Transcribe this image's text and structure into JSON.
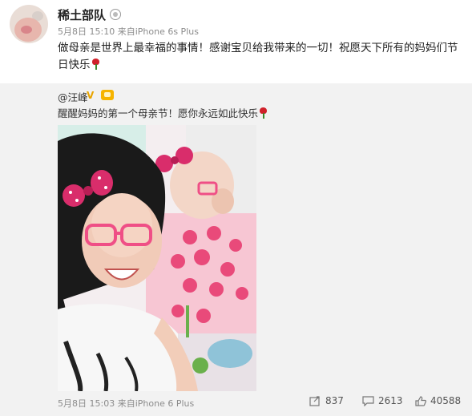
{
  "post": {
    "username": "稀土部队",
    "date": "5月8日",
    "time": "15:10",
    "source": "来自iPhone 6s Plus",
    "text": "做母亲是世界上最幸福的事情！感谢宝贝给我带来的一切！祝愿天下所有的妈妈们节日快乐"
  },
  "repost": {
    "author": "@汪峰",
    "text": "醒醒妈妈的第一个母亲节！愿你永远如此快乐",
    "date": "5月8日",
    "time": "15:03",
    "source": "来自iPhone 6 Plus",
    "reposts": "837",
    "comments": "2613",
    "likes": "40588"
  },
  "icons": {
    "repost": "repost-icon",
    "comment": "comment-icon",
    "like": "like-icon",
    "rose": "rose-emoji-icon",
    "verified": "verified-v-icon",
    "member": "member-badge-icon"
  },
  "colors": {
    "background": "#ffffff",
    "repost_background": "#f2f2f2",
    "meta_text": "#8c8c8c",
    "verified": "#e8a400"
  }
}
